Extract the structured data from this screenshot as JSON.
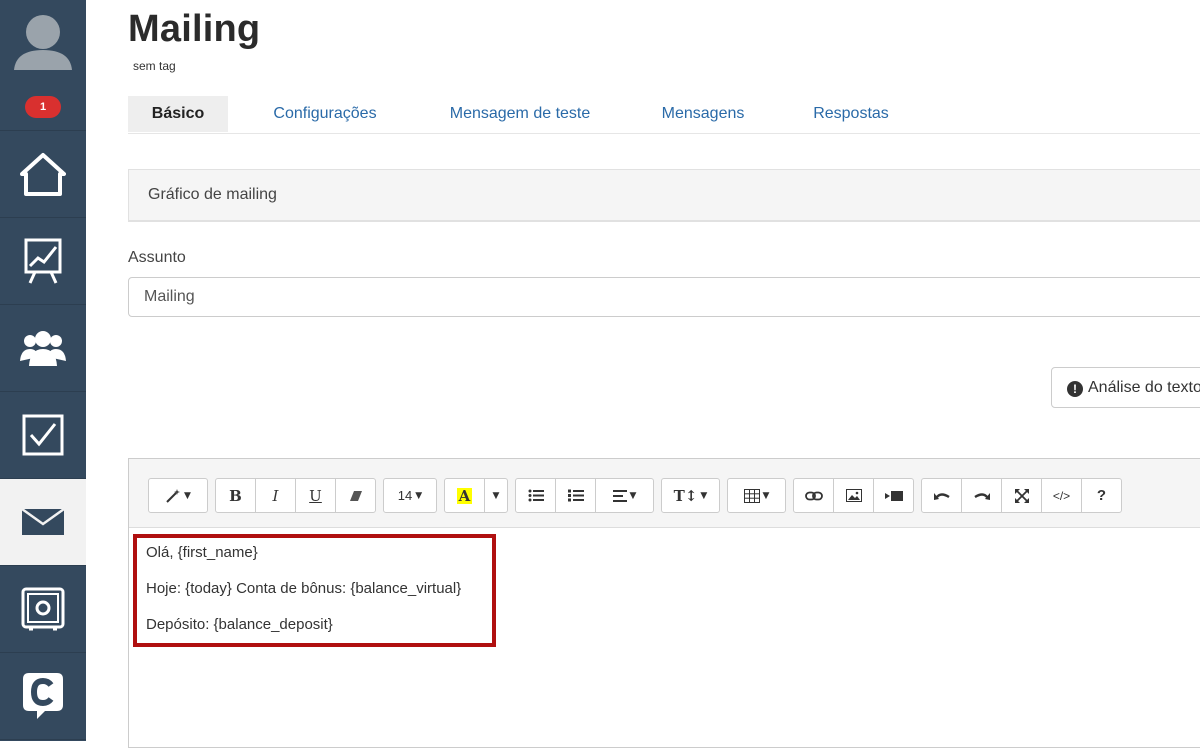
{
  "sidebar": {
    "badge": "1",
    "items": [
      {
        "icon": "home-icon"
      },
      {
        "icon": "chart-icon"
      },
      {
        "icon": "users-icon"
      },
      {
        "icon": "tasks-icon"
      },
      {
        "icon": "mail-icon",
        "active": true
      },
      {
        "icon": "safe-icon"
      },
      {
        "icon": "chat-icon"
      }
    ]
  },
  "header": {
    "title": "Mailing",
    "subtitle": "sem tag"
  },
  "tabs": [
    {
      "label": "Básico",
      "active": true
    },
    {
      "label": "Configurações"
    },
    {
      "label": "Mensagem de teste"
    },
    {
      "label": "Mensagens"
    },
    {
      "label": "Respostas"
    }
  ],
  "panel": {
    "title": "Gráfico de mailing"
  },
  "subject": {
    "label": "Assunto",
    "value": "Mailing"
  },
  "analysis_button": {
    "label": "Análise do texto"
  },
  "editor": {
    "font_size": "14",
    "lines": [
      "Olá, {first_name}",
      "Hoje: {today} Conta de bônus: {balance_virtual}",
      "Depósito: {balance_deposit}"
    ]
  },
  "colors": {
    "sidebar_bg": "#34495e",
    "link": "#2a6aa8",
    "badge": "#d9302f",
    "highlight_border": "#b01010"
  }
}
